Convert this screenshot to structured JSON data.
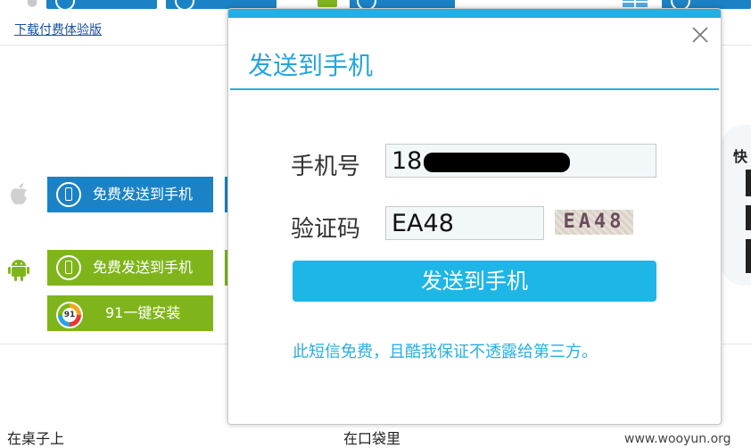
{
  "background": {
    "download_paid_link": "下载付费体验版",
    "ios_send_button": "免费发送到手机",
    "android_send_button": "免费发送到手机",
    "one_click_install_button": "91一键安装",
    "bottom_left_text": "在桌子上",
    "bottom_mid_text": "在口袋里",
    "qr_label": "快"
  },
  "dialog": {
    "title": "发送到手机",
    "phone_label": "手机号",
    "phone_value": "18",
    "code_label": "验证码",
    "code_value": "EA48",
    "captcha_text": "EA48",
    "send_button": "发送到手机",
    "notice": "此短信免费，且酷我保证不透露给第三方。"
  },
  "watermark": "www.wooyun.org",
  "colors": {
    "accent": "#24aee1",
    "send_button": "#1db6e7",
    "blue_button": "#1b82c6",
    "green_button": "#7fb51b"
  }
}
